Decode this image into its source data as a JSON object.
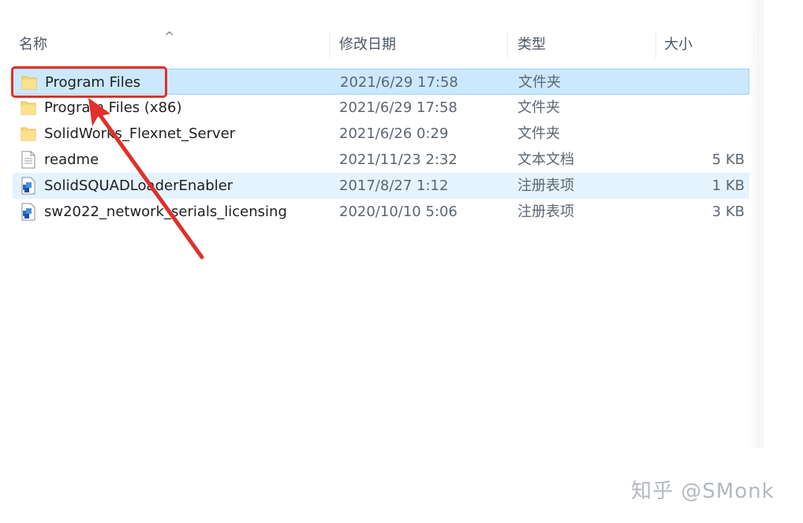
{
  "columns": {
    "name": "名称",
    "modified": "修改日期",
    "type": "类型",
    "size": "大小"
  },
  "sort_indicator": "^",
  "files": [
    {
      "name": "Program Files",
      "modified": "2021/6/29 17:58",
      "type": "文件夹",
      "size": "",
      "icon": "folder-icon",
      "selected": true
    },
    {
      "name": "Program Files (x86)",
      "modified": "2021/6/29 17:58",
      "type": "文件夹",
      "size": "",
      "icon": "folder-icon",
      "selected": false
    },
    {
      "name": "SolidWorks_Flexnet_Server",
      "modified": "2021/6/26 0:29",
      "type": "文件夹",
      "size": "",
      "icon": "folder-icon",
      "selected": false
    },
    {
      "name": "readme",
      "modified": "2021/11/23 2:32",
      "type": "文本文档",
      "size": "5 KB",
      "icon": "text-document-icon",
      "selected": false
    },
    {
      "name": "SolidSQUADLoaderEnabler",
      "modified": "2017/8/27 1:12",
      "type": "注册表项",
      "size": "1 KB",
      "icon": "registry-file-icon",
      "selected": false,
      "hover": true
    },
    {
      "name": "sw2022_network_serials_licensing",
      "modified": "2020/10/10 5:06",
      "type": "注册表项",
      "size": "3 KB",
      "icon": "registry-file-icon",
      "selected": false
    }
  ],
  "annotation": {
    "highlight_color": "#e0302b",
    "target": "Program Files"
  },
  "watermark": "知乎 @SMonk",
  "colors": {
    "selection_bg": "#cce8ff",
    "selection_border": "#99d1ff",
    "hover_bg": "#e5f3ff",
    "folder": "#f8d775"
  }
}
